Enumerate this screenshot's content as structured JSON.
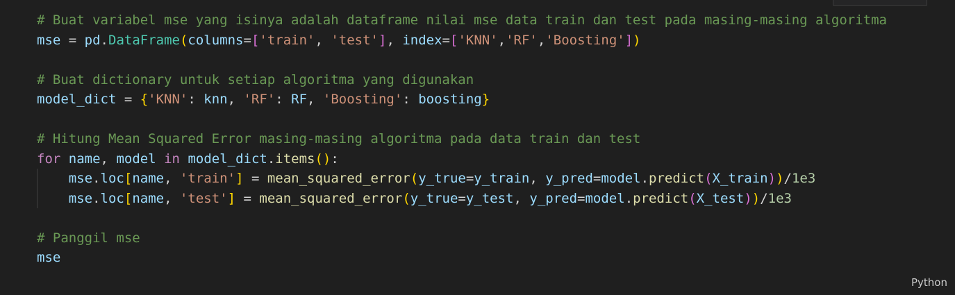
{
  "cell": {
    "language_label": "Python",
    "lines": [
      {
        "tokens": [
          {
            "t": "# Buat variabel mse yang isinya adalah dataframe nilai mse data train dan test pada masing-masing algoritma",
            "c": "comment"
          }
        ]
      },
      {
        "tokens": [
          {
            "t": "mse",
            "c": "var"
          },
          {
            "t": " = ",
            "c": "op"
          },
          {
            "t": "pd",
            "c": "var"
          },
          {
            "t": ".",
            "c": "op"
          },
          {
            "t": "DataFrame",
            "c": "class"
          },
          {
            "t": "(",
            "c": "b1"
          },
          {
            "t": "columns",
            "c": "var"
          },
          {
            "t": "=",
            "c": "op"
          },
          {
            "t": "[",
            "c": "b2"
          },
          {
            "t": "'train'",
            "c": "str"
          },
          {
            "t": ", ",
            "c": "op"
          },
          {
            "t": "'test'",
            "c": "str"
          },
          {
            "t": "]",
            "c": "b2"
          },
          {
            "t": ", ",
            "c": "op"
          },
          {
            "t": "index",
            "c": "var"
          },
          {
            "t": "=",
            "c": "op"
          },
          {
            "t": "[",
            "c": "b2"
          },
          {
            "t": "'KNN'",
            "c": "str"
          },
          {
            "t": ",",
            "c": "op"
          },
          {
            "t": "'RF'",
            "c": "str"
          },
          {
            "t": ",",
            "c": "op"
          },
          {
            "t": "'Boosting'",
            "c": "str"
          },
          {
            "t": "]",
            "c": "b2"
          },
          {
            "t": ")",
            "c": "b1"
          }
        ]
      },
      {
        "tokens": []
      },
      {
        "tokens": [
          {
            "t": "# Buat dictionary untuk setiap algoritma yang digunakan",
            "c": "comment"
          }
        ]
      },
      {
        "tokens": [
          {
            "t": "model_dict",
            "c": "var"
          },
          {
            "t": " = ",
            "c": "op"
          },
          {
            "t": "{",
            "c": "b1"
          },
          {
            "t": "'KNN'",
            "c": "str"
          },
          {
            "t": ": ",
            "c": "op"
          },
          {
            "t": "knn",
            "c": "var"
          },
          {
            "t": ", ",
            "c": "op"
          },
          {
            "t": "'RF'",
            "c": "str"
          },
          {
            "t": ": ",
            "c": "op"
          },
          {
            "t": "RF",
            "c": "var"
          },
          {
            "t": ", ",
            "c": "op"
          },
          {
            "t": "'Boosting'",
            "c": "str"
          },
          {
            "t": ": ",
            "c": "op"
          },
          {
            "t": "boosting",
            "c": "var"
          },
          {
            "t": "}",
            "c": "b1"
          }
        ]
      },
      {
        "tokens": []
      },
      {
        "tokens": [
          {
            "t": "# Hitung Mean Squared Error masing-masing algoritma pada data train dan test",
            "c": "comment"
          }
        ]
      },
      {
        "tokens": [
          {
            "t": "for",
            "c": "kw"
          },
          {
            "t": " ",
            "c": "op"
          },
          {
            "t": "name",
            "c": "var"
          },
          {
            "t": ", ",
            "c": "op"
          },
          {
            "t": "model",
            "c": "var"
          },
          {
            "t": " ",
            "c": "op"
          },
          {
            "t": "in",
            "c": "kw"
          },
          {
            "t": " ",
            "c": "op"
          },
          {
            "t": "model_dict",
            "c": "var"
          },
          {
            "t": ".",
            "c": "op"
          },
          {
            "t": "items",
            "c": "func"
          },
          {
            "t": "()",
            "c": "b1"
          },
          {
            "t": ":",
            "c": "op"
          }
        ]
      },
      {
        "indent": true,
        "tokens": [
          {
            "t": "    ",
            "c": "op"
          },
          {
            "t": "mse",
            "c": "var"
          },
          {
            "t": ".",
            "c": "op"
          },
          {
            "t": "loc",
            "c": "var"
          },
          {
            "t": "[",
            "c": "b1"
          },
          {
            "t": "name",
            "c": "var"
          },
          {
            "t": ", ",
            "c": "op"
          },
          {
            "t": "'train'",
            "c": "str"
          },
          {
            "t": "]",
            "c": "b1"
          },
          {
            "t": " = ",
            "c": "op"
          },
          {
            "t": "mean_squared_error",
            "c": "func"
          },
          {
            "t": "(",
            "c": "b1"
          },
          {
            "t": "y_true",
            "c": "var"
          },
          {
            "t": "=",
            "c": "op"
          },
          {
            "t": "y_train",
            "c": "var"
          },
          {
            "t": ", ",
            "c": "op"
          },
          {
            "t": "y_pred",
            "c": "var"
          },
          {
            "t": "=",
            "c": "op"
          },
          {
            "t": "model",
            "c": "var"
          },
          {
            "t": ".",
            "c": "op"
          },
          {
            "t": "predict",
            "c": "func"
          },
          {
            "t": "(",
            "c": "b2"
          },
          {
            "t": "X_train",
            "c": "var"
          },
          {
            "t": ")",
            "c": "b2"
          },
          {
            "t": ")",
            "c": "b1"
          },
          {
            "t": "/",
            "c": "op"
          },
          {
            "t": "1e3",
            "c": "num"
          }
        ]
      },
      {
        "indent": true,
        "tokens": [
          {
            "t": "    ",
            "c": "op"
          },
          {
            "t": "mse",
            "c": "var"
          },
          {
            "t": ".",
            "c": "op"
          },
          {
            "t": "loc",
            "c": "var"
          },
          {
            "t": "[",
            "c": "b1"
          },
          {
            "t": "name",
            "c": "var"
          },
          {
            "t": ", ",
            "c": "op"
          },
          {
            "t": "'test'",
            "c": "str"
          },
          {
            "t": "]",
            "c": "b1"
          },
          {
            "t": " = ",
            "c": "op"
          },
          {
            "t": "mean_squared_error",
            "c": "func"
          },
          {
            "t": "(",
            "c": "b1"
          },
          {
            "t": "y_true",
            "c": "var"
          },
          {
            "t": "=",
            "c": "op"
          },
          {
            "t": "y_test",
            "c": "var"
          },
          {
            "t": ", ",
            "c": "op"
          },
          {
            "t": "y_pred",
            "c": "var"
          },
          {
            "t": "=",
            "c": "op"
          },
          {
            "t": "model",
            "c": "var"
          },
          {
            "t": ".",
            "c": "op"
          },
          {
            "t": "predict",
            "c": "func"
          },
          {
            "t": "(",
            "c": "b2"
          },
          {
            "t": "X_test",
            "c": "var"
          },
          {
            "t": ")",
            "c": "b2"
          },
          {
            "t": ")",
            "c": "b1"
          },
          {
            "t": "/",
            "c": "op"
          },
          {
            "t": "1e3",
            "c": "num"
          }
        ]
      },
      {
        "tokens": []
      },
      {
        "tokens": [
          {
            "t": "# Panggil mse",
            "c": "comment"
          }
        ]
      },
      {
        "tokens": [
          {
            "t": "mse",
            "c": "var"
          }
        ]
      }
    ]
  }
}
